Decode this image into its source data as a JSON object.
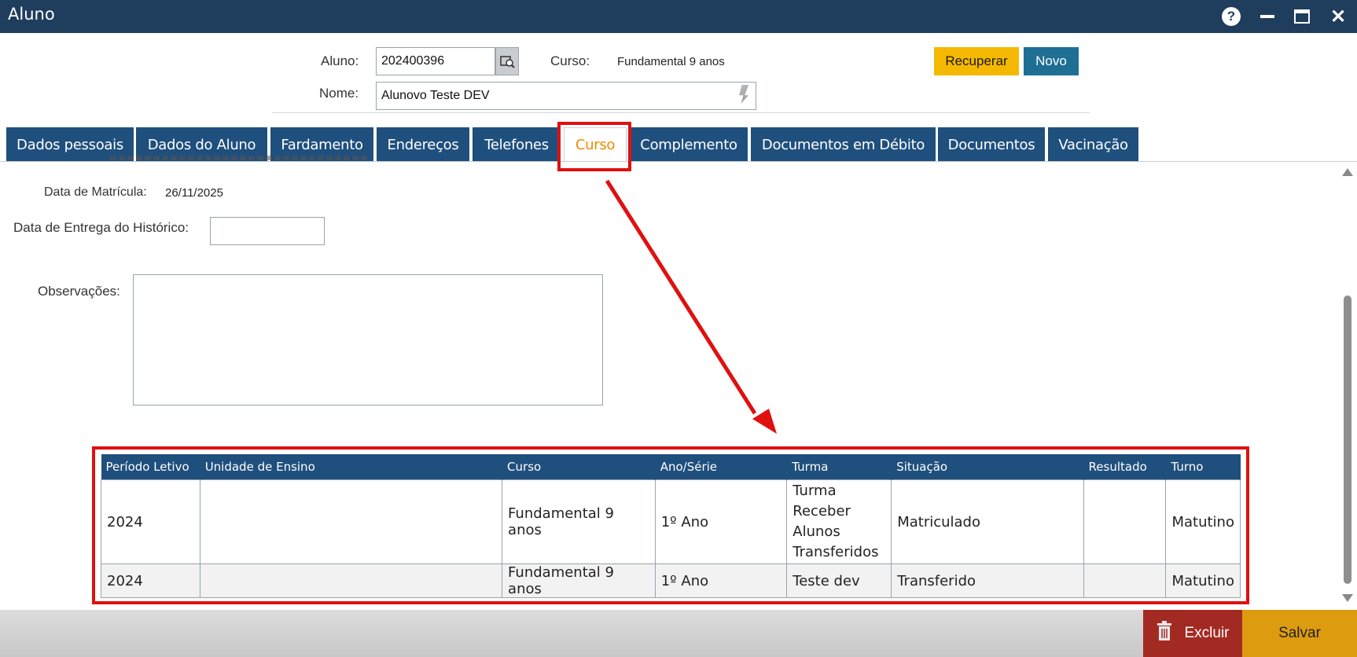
{
  "window": {
    "title": "Aluno"
  },
  "header": {
    "aluno_label": "Aluno:",
    "aluno_value": "202400396",
    "curso_label": "Curso:",
    "curso_value": "Fundamental 9 anos",
    "nome_label": "Nome:",
    "nome_value": "Alunovo Teste DEV",
    "recuperar_label": "Recuperar",
    "novo_label": "Novo"
  },
  "tabs": [
    {
      "label": "Dados pessoais"
    },
    {
      "label": "Dados do Aluno"
    },
    {
      "label": "Fardamento"
    },
    {
      "label": "Endereços"
    },
    {
      "label": "Telefones"
    },
    {
      "label": "Curso",
      "active": true
    },
    {
      "label": "Complemento"
    },
    {
      "label": "Documentos em Débito"
    },
    {
      "label": "Documentos"
    },
    {
      "label": "Vacinação"
    }
  ],
  "form": {
    "data_matricula_label": "Data de Matrícula:",
    "data_matricula_value": "26/11/2025",
    "data_entrega_label": "Data de Entrega do Histórico:",
    "data_entrega_value": "",
    "observacoes_label": "Observações:",
    "observacoes_value": ""
  },
  "table": {
    "headers": [
      "Período Letivo",
      "Unidade de Ensino",
      "Curso",
      "Ano/Série",
      "Turma",
      "Situação",
      "Resultado",
      "Turno"
    ],
    "rows": [
      [
        "2024",
        "",
        "Fundamental 9 anos",
        "1º Ano",
        "Turma Receber Alunos Transferidos",
        "Matriculado",
        "",
        "Matutino"
      ],
      [
        "2024",
        "",
        "Fundamental 9 anos",
        "1º Ano",
        "Teste dev",
        "Transferido",
        "",
        "Matutino"
      ]
    ]
  },
  "footer": {
    "excluir_label": "Excluir",
    "salvar_label": "Salvar"
  },
  "colors": {
    "titlebar": "#1f3d5c",
    "tab": "#1f4f7d",
    "active_tab_text": "#f08a00",
    "recuperar": "#f5b800",
    "novo": "#1f6f94",
    "excluir": "#a32a22",
    "salvar": "#dd9c10",
    "annotation": "#e01010"
  }
}
